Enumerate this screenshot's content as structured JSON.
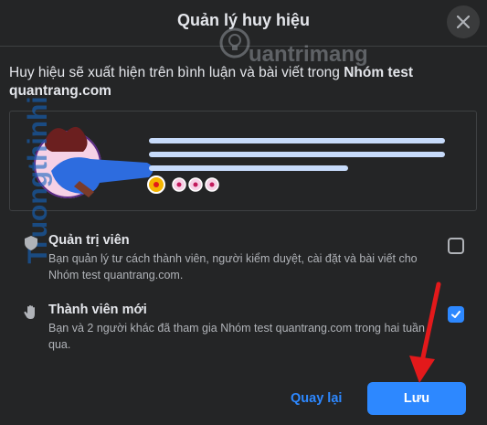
{
  "dialog": {
    "title": "Quản lý huy hiệu",
    "description_prefix": "Huy hiệu sẽ xuất hiện trên bình luận và bài viết trong ",
    "group_name": "Nhóm test quantrang.com"
  },
  "watermark": {
    "brand_text": "uantrimang",
    "side_text": "Truongthinhi"
  },
  "badges": [
    {
      "icon": "shield-icon",
      "title": "Quản trị viên",
      "description": "Bạn quản lý tư cách thành viên, người kiểm duyệt, cài đặt và bài viết cho Nhóm test quantrang.com.",
      "checked": false
    },
    {
      "icon": "wave-hand-icon",
      "title": "Thành viên mới",
      "description": "Bạn và 2 người khác đã tham gia Nhóm test quantrang.com trong hai tuần qua.",
      "checked": true
    }
  ],
  "footer": {
    "back_label": "Quay lại",
    "save_label": "Lưu"
  },
  "colors": {
    "accent": "#2d88ff",
    "annotation_arrow": "#e3191b",
    "background": "#242526"
  }
}
